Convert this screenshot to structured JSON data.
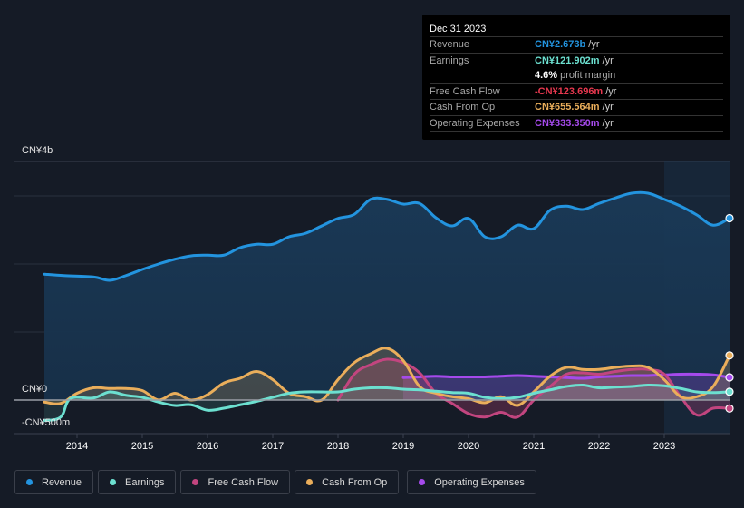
{
  "tooltip": {
    "date": "Dec 31 2023",
    "rows": [
      {
        "key": "Revenue",
        "value": "CN¥2.673b",
        "unit": "/yr",
        "color": "#2394df"
      },
      {
        "key": "Earnings",
        "value": "CN¥121.902m",
        "unit": "/yr",
        "color": "#6ce0d0"
      },
      {
        "key": "",
        "value": "4.6%",
        "unit": "profit margin",
        "color": "#ffffff"
      },
      {
        "key": "Free Cash Flow",
        "value": "-CN¥123.696m",
        "unit": "/yr",
        "color": "#e8384f"
      },
      {
        "key": "Cash From Op",
        "value": "CN¥655.564m",
        "unit": "/yr",
        "color": "#eaae5b"
      },
      {
        "key": "Operating Expenses",
        "value": "CN¥333.350m",
        "unit": "/yr",
        "color": "#a54aec"
      }
    ]
  },
  "legend": [
    {
      "label": "Revenue",
      "color": "#2394df"
    },
    {
      "label": "Earnings",
      "color": "#6ce0d0"
    },
    {
      "label": "Free Cash Flow",
      "color": "#c2457f"
    },
    {
      "label": "Cash From Op",
      "color": "#eaae5b"
    },
    {
      "label": "Operating Expenses",
      "color": "#a54aec"
    }
  ],
  "chart_data": {
    "type": "area",
    "title": "",
    "xlabel": "",
    "ylabel": "",
    "y_unit": "CN¥ billions",
    "ylim": [
      -0.5,
      4
    ],
    "xlim": [
      2013.5,
      2024.0
    ],
    "y_tick_labels": [
      {
        "value": 4,
        "label": "CN¥4b"
      },
      {
        "value": 0,
        "label": "CN¥0"
      },
      {
        "value": -0.5,
        "label": "-CN¥500m"
      }
    ],
    "gridlines": [
      3,
      2,
      1
    ],
    "x_ticks": [
      2014,
      2015,
      2016,
      2017,
      2018,
      2019,
      2020,
      2021,
      2022,
      2023
    ],
    "forecast_region_start": 2023.0,
    "series": [
      {
        "name": "Revenue",
        "color": "#2394df",
        "x": [
          2013.5,
          2013.8,
          2014.25,
          2014.5,
          2014.75,
          2015.0,
          2015.25,
          2015.5,
          2015.75,
          2016.0,
          2016.25,
          2016.5,
          2016.75,
          2017.0,
          2017.25,
          2017.5,
          2017.75,
          2018.0,
          2018.25,
          2018.5,
          2018.75,
          2019.0,
          2019.25,
          2019.5,
          2019.75,
          2020.0,
          2020.25,
          2020.5,
          2020.75,
          2021.0,
          2021.25,
          2021.5,
          2021.75,
          2022.0,
          2022.25,
          2022.5,
          2022.75,
          2023.0,
          2023.25,
          2023.5,
          2023.75,
          2024.0
        ],
        "values": [
          1.85,
          1.83,
          1.81,
          1.76,
          1.83,
          1.92,
          2.0,
          2.07,
          2.12,
          2.13,
          2.13,
          2.24,
          2.29,
          2.29,
          2.4,
          2.45,
          2.56,
          2.67,
          2.73,
          2.95,
          2.95,
          2.88,
          2.89,
          2.68,
          2.56,
          2.67,
          2.4,
          2.4,
          2.57,
          2.52,
          2.79,
          2.85,
          2.8,
          2.89,
          2.97,
          3.04,
          3.04,
          2.95,
          2.85,
          2.72,
          2.57,
          2.673
        ]
      },
      {
        "name": "Earnings",
        "color": "#6ce0d0",
        "x": [
          2013.5,
          2013.75,
          2013.9,
          2014.25,
          2014.5,
          2014.75,
          2015.0,
          2015.25,
          2015.5,
          2015.75,
          2016.0,
          2016.25,
          2016.5,
          2016.75,
          2017.0,
          2017.25,
          2017.5,
          2017.75,
          2018.0,
          2018.25,
          2018.5,
          2018.75,
          2019.0,
          2019.25,
          2019.5,
          2019.75,
          2020.0,
          2020.25,
          2020.5,
          2020.75,
          2021.0,
          2021.25,
          2021.5,
          2021.75,
          2022.0,
          2022.25,
          2022.5,
          2022.75,
          2023.0,
          2023.25,
          2023.5,
          2023.75,
          2024.0
        ],
        "values": [
          -0.3,
          -0.25,
          0.02,
          0.03,
          0.12,
          0.07,
          0.04,
          -0.03,
          -0.08,
          -0.07,
          -0.15,
          -0.12,
          -0.07,
          -0.02,
          0.04,
          0.1,
          0.12,
          0.12,
          0.12,
          0.16,
          0.18,
          0.18,
          0.16,
          0.15,
          0.13,
          0.11,
          0.1,
          0.04,
          0.02,
          0.04,
          0.1,
          0.15,
          0.2,
          0.22,
          0.18,
          0.19,
          0.2,
          0.22,
          0.21,
          0.17,
          0.12,
          0.11,
          0.122
        ]
      },
      {
        "name": "Free Cash Flow",
        "color": "#c2457f",
        "x": [
          2018.0,
          2018.25,
          2018.5,
          2018.75,
          2019.0,
          2019.25,
          2019.5,
          2019.75,
          2020.0,
          2020.25,
          2020.5,
          2020.75,
          2021.0,
          2021.25,
          2021.5,
          2021.75,
          2022.0,
          2022.25,
          2022.5,
          2022.75,
          2023.0,
          2023.25,
          2023.5,
          2023.75,
          2024.0
        ],
        "values": [
          0.0,
          0.38,
          0.52,
          0.6,
          0.55,
          0.4,
          0.1,
          -0.05,
          -0.2,
          -0.25,
          -0.18,
          -0.25,
          0.0,
          0.2,
          0.38,
          0.4,
          0.38,
          0.42,
          0.45,
          0.45,
          0.38,
          0.05,
          -0.22,
          -0.12,
          -0.124
        ]
      },
      {
        "name": "Cash From Op",
        "color": "#eaae5b",
        "x": [
          2013.5,
          2013.75,
          2014.0,
          2014.25,
          2014.5,
          2014.75,
          2015.0,
          2015.25,
          2015.5,
          2015.75,
          2016.0,
          2016.25,
          2016.5,
          2016.75,
          2017.0,
          2017.25,
          2017.5,
          2017.75,
          2018.0,
          2018.25,
          2018.5,
          2018.75,
          2019.0,
          2019.25,
          2019.5,
          2019.75,
          2020.0,
          2020.25,
          2020.5,
          2020.75,
          2021.0,
          2021.25,
          2021.5,
          2021.75,
          2022.0,
          2022.25,
          2022.5,
          2022.75,
          2023.0,
          2023.25,
          2023.5,
          2023.75,
          2024.0
        ],
        "values": [
          -0.03,
          -0.05,
          0.1,
          0.18,
          0.17,
          0.17,
          0.14,
          0.0,
          0.1,
          0.0,
          0.08,
          0.25,
          0.32,
          0.42,
          0.3,
          0.1,
          0.05,
          0.0,
          0.3,
          0.55,
          0.68,
          0.76,
          0.58,
          0.2,
          0.1,
          0.05,
          0.02,
          -0.04,
          0.05,
          -0.08,
          0.12,
          0.35,
          0.48,
          0.45,
          0.45,
          0.48,
          0.5,
          0.48,
          0.3,
          0.05,
          0.05,
          0.2,
          0.656
        ]
      },
      {
        "name": "Operating Expenses",
        "color": "#a54aec",
        "x": [
          2019.0,
          2019.25,
          2019.5,
          2019.75,
          2020.0,
          2020.25,
          2020.5,
          2020.75,
          2021.0,
          2021.25,
          2021.5,
          2021.75,
          2022.0,
          2022.25,
          2022.5,
          2022.75,
          2023.0,
          2023.25,
          2023.5,
          2023.75,
          2024.0
        ],
        "values": [
          0.33,
          0.34,
          0.35,
          0.34,
          0.34,
          0.34,
          0.35,
          0.36,
          0.35,
          0.34,
          0.33,
          0.32,
          0.34,
          0.35,
          0.36,
          0.36,
          0.37,
          0.38,
          0.38,
          0.37,
          0.333
        ]
      }
    ]
  }
}
